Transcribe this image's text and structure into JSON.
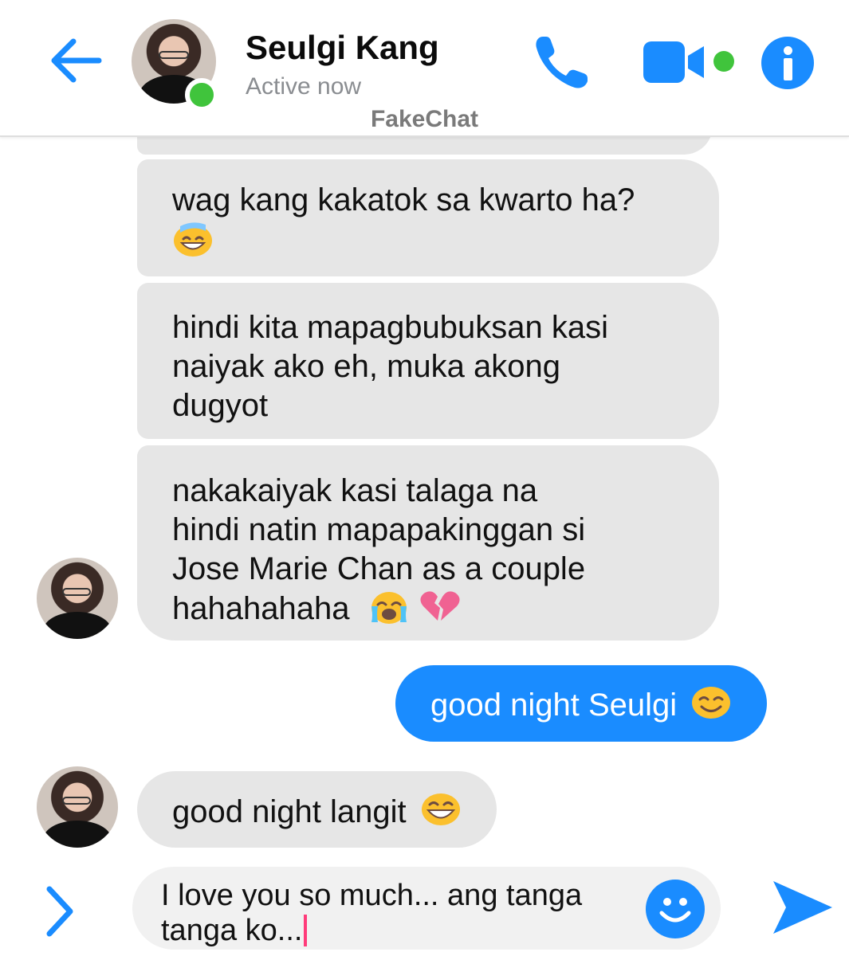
{
  "header": {
    "contact_name": "Seulgi Kang",
    "status": "Active now",
    "watermark": "FakeChat",
    "icons": [
      "back-arrow-icon",
      "avatar",
      "online-indicator",
      "phone-icon",
      "video-camera-icon",
      "info-icon"
    ]
  },
  "messages": [
    {
      "from": "contact",
      "text": "wag kang kakatok sa kwarto ha?",
      "emojis": [
        "sweat-smile-emoji"
      ]
    },
    {
      "from": "contact",
      "lines": [
        "hindi kita mapagbubuksan kasi",
        "naiyak ako eh, muka akong",
        "dugyot"
      ]
    },
    {
      "from": "contact",
      "lines": [
        "nakakaiyak kasi talaga na",
        "hindi natin mapapakinggan si",
        "Jose Marie Chan as a couple",
        "hahahahaha"
      ],
      "emojis": [
        "loudly-crying-emoji",
        "broken-heart-emoji"
      ]
    },
    {
      "from": "me",
      "text": "good night Seulgi",
      "emojis": [
        "smiling-blush-emoji"
      ]
    },
    {
      "from": "contact",
      "text": "good night langit",
      "emojis": [
        "grinning-smile-emoji"
      ]
    }
  ],
  "composer": {
    "value": "I love you so much... ang tanga tanga ko...",
    "icons": [
      "chevron-right-icon",
      "emoji-smiley-icon",
      "send-icon"
    ]
  },
  "colors": {
    "accent": "#1a8cff",
    "online": "#40c43c",
    "incoming_bubble": "#e6e6e6",
    "caret": "#ff3b7a"
  }
}
